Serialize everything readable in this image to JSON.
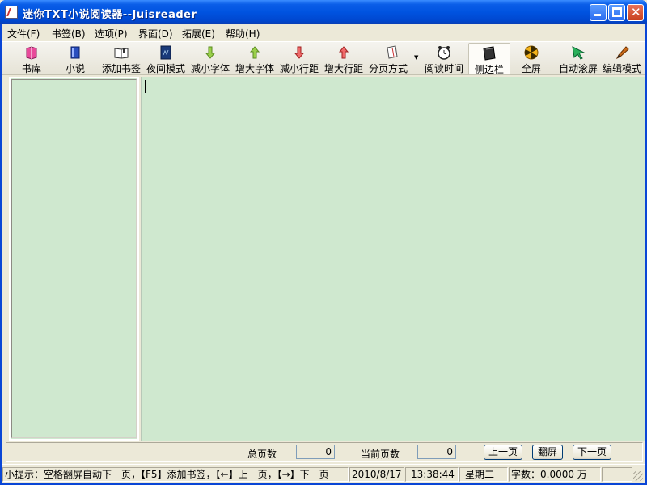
{
  "window": {
    "title": "迷你TXT小说阅读器--Juisreader"
  },
  "menu": [
    {
      "label": "文件(F)"
    },
    {
      "label": "书签(B)"
    },
    {
      "label": "选项(P)"
    },
    {
      "label": "界面(D)"
    },
    {
      "label": "拓展(E)"
    },
    {
      "label": "帮助(H)"
    }
  ],
  "toolbar": [
    {
      "label": "书库",
      "icon": "bookshelf-icon"
    },
    {
      "label": "小说",
      "icon": "book-icon"
    },
    {
      "label": "添加书签",
      "icon": "bookmark-add-icon"
    },
    {
      "label": "夜间模式",
      "icon": "night-mode-icon"
    },
    {
      "label": "减小字体",
      "icon": "font-decrease-icon"
    },
    {
      "label": "增大字体",
      "icon": "font-increase-icon"
    },
    {
      "label": "减小行距",
      "icon": "line-spacing-decrease-icon"
    },
    {
      "label": "增大行距",
      "icon": "line-spacing-increase-icon"
    },
    {
      "label": "分页方式",
      "icon": "pagination-icon"
    },
    {
      "label": "阅读时间",
      "icon": "clock-icon"
    },
    {
      "label": "侧边栏",
      "icon": "sidebar-icon"
    },
    {
      "label": "全屏",
      "icon": "fullscreen-icon"
    },
    {
      "label": "自动滚屏",
      "icon": "auto-scroll-icon"
    },
    {
      "label": "编辑模式",
      "icon": "edit-mode-icon"
    }
  ],
  "colors": {
    "reader_bg": "#cfe8cf",
    "title_blue": "#0053e0"
  },
  "nav": {
    "total_label": "总页数",
    "total_value": "0",
    "current_label": "当前页数",
    "current_value": "0",
    "prev": "上一页",
    "flip": "翻屏",
    "next": "下一页"
  },
  "status": {
    "tip": "小提示：空格翻屏自动下一页，【F5】添加书签，【←】上一页，【→】下一页",
    "date": "2010/8/17",
    "time": "13:38:44",
    "weekday": "星期二",
    "word_count": "字数：0.0000 万"
  }
}
